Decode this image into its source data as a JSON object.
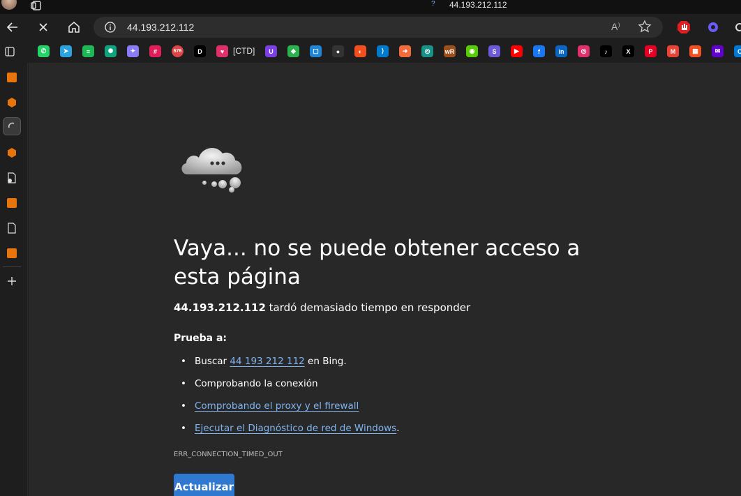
{
  "titlebar": {
    "tab_title": "44.193.212.112",
    "tab_badge": "?"
  },
  "addressbar": {
    "url": "44.193.212.112",
    "read_aloud_label": "A⁾"
  },
  "favorites": {
    "ctd_label": "[CTD]",
    "speed_badge": "676",
    "icons": [
      {
        "name": "whatsapp-icon",
        "color": "#25d366"
      },
      {
        "name": "telegram-icon",
        "color": "#2aa3e0"
      },
      {
        "name": "spotify-icon",
        "color": "#1db954"
      },
      {
        "name": "chatgpt-icon",
        "color": "#10a37f"
      },
      {
        "name": "gemini-icon",
        "color": "#8a7cf6"
      },
      {
        "name": "slack-icon",
        "color": "#e01e5a"
      },
      {
        "name": "speedtest-icon",
        "color": "#e04545"
      },
      {
        "name": "dm-icon",
        "color": "#000000"
      },
      {
        "name": "ctd-icon",
        "color": "#e0306a"
      },
      {
        "name": "uphold-icon",
        "color": "#7b3fe4"
      },
      {
        "name": "feedly-icon",
        "color": "#2bb24c"
      },
      {
        "name": "window-icon",
        "color": "#1f86d6"
      },
      {
        "name": "github-icon",
        "color": "#333333"
      },
      {
        "name": "figma-icon",
        "color": "#f24e1e"
      },
      {
        "name": "vscode-icon",
        "color": "#007acc"
      },
      {
        "name": "arrow-icon",
        "color": "#f26b3a"
      },
      {
        "name": "gitkraken-icon",
        "color": "#179287"
      },
      {
        "name": "wr-icon",
        "color": "#9b4f1b"
      },
      {
        "name": "duolingo-icon",
        "color": "#58cc02"
      },
      {
        "name": "s-app-icon",
        "color": "#6b5bd6"
      },
      {
        "name": "youtube-icon",
        "color": "#ff0000"
      },
      {
        "name": "facebook-icon",
        "color": "#1877f2"
      },
      {
        "name": "linkedin-icon",
        "color": "#0a66c2"
      },
      {
        "name": "instagram-icon",
        "color": "#e1306c"
      },
      {
        "name": "tiktok-icon",
        "color": "#000000"
      },
      {
        "name": "x-icon",
        "color": "#000000"
      },
      {
        "name": "pinterest-icon",
        "color": "#e60023"
      },
      {
        "name": "gmail-icon",
        "color": "#ea4335"
      },
      {
        "name": "microsoft-icon",
        "color": "#f25022"
      },
      {
        "name": "yahoo-mail-icon",
        "color": "#6001d2"
      },
      {
        "name": "outlook-icon",
        "color": "#0078d4"
      }
    ]
  },
  "error_page": {
    "title": "Vaya... no se puede obtener acceso a esta página",
    "host": "44.193.212.112",
    "subtitle_rest": " tardó demasiado tiempo en responder",
    "try_label": "Prueba a:",
    "suggestions": {
      "search_prefix": "Buscar ",
      "search_link": "44 193 212 112",
      "search_suffix": " en Bing.",
      "check_connection": "Comprobando la conexión",
      "check_proxy": "Comprobando el proxy y el firewall",
      "diagnostics": "Ejecutar el Diagnóstico de red de Windows",
      "diagnostics_suffix": "."
    },
    "error_code": "ERR_CONNECTION_TIMED_OUT",
    "refresh_label": "Actualizar"
  },
  "colors": {
    "link": "#7fb4f0",
    "button": "#2f7ad0",
    "page_bg": "#282828"
  }
}
